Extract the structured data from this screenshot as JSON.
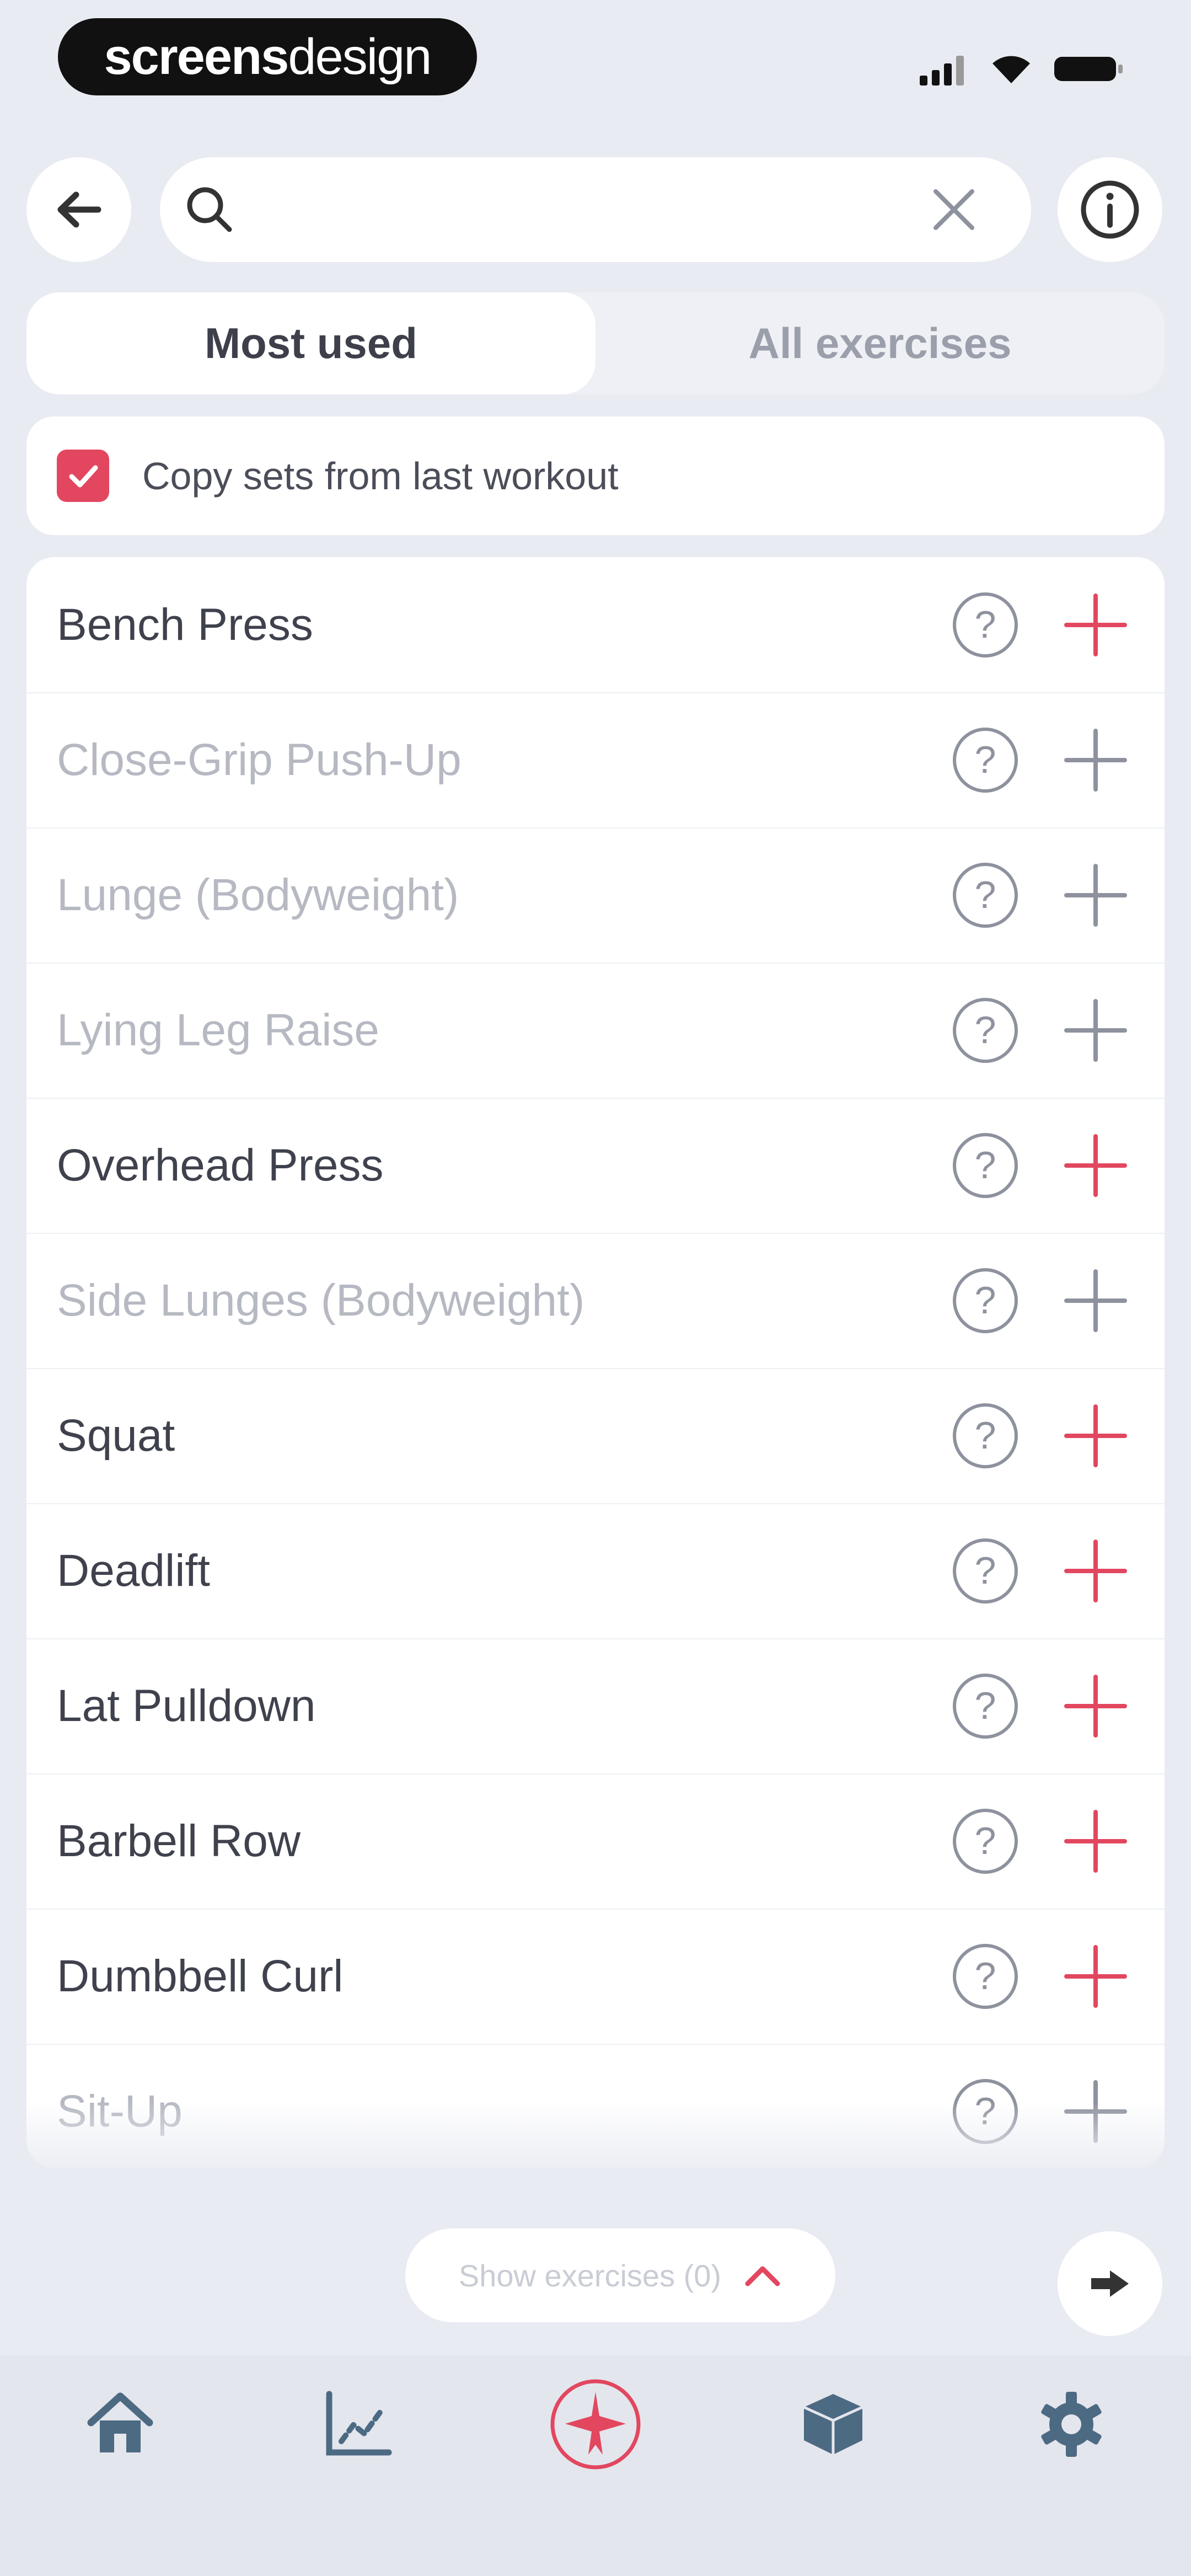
{
  "status_bar": {
    "brand": {
      "bold": "screens",
      "light": "design"
    },
    "icons": [
      "signal-icon",
      "wifi-icon",
      "battery-icon"
    ]
  },
  "header": {
    "back_icon": "arrow-left-icon",
    "search": {
      "placeholder": "",
      "value": ""
    },
    "clear_icon": "close-icon",
    "info_icon": "info-icon"
  },
  "tabs": [
    {
      "label": "Most used",
      "active": true
    },
    {
      "label": "All exercises",
      "active": false
    }
  ],
  "copy_sets": {
    "label": "Copy sets from last workout",
    "checked": true
  },
  "exercises": [
    {
      "name": "Bench Press",
      "used": true
    },
    {
      "name": "Close-Grip Push-Up",
      "used": false
    },
    {
      "name": "Lunge (Bodyweight)",
      "used": false
    },
    {
      "name": "Lying Leg Raise",
      "used": false
    },
    {
      "name": "Overhead Press",
      "used": true
    },
    {
      "name": "Side Lunges (Bodyweight)",
      "used": false
    },
    {
      "name": "Squat",
      "used": true
    },
    {
      "name": "Deadlift",
      "used": true
    },
    {
      "name": "Lat Pulldown",
      "used": true
    },
    {
      "name": "Barbell Row",
      "used": true
    },
    {
      "name": "Dumbbell Curl",
      "used": true
    },
    {
      "name": "Sit-Up",
      "used": false
    }
  ],
  "show_exercises": {
    "label": "Show exercises (0)",
    "icon": "chevron-up-icon"
  },
  "next_icon": "arrow-right-icon",
  "bottom_nav": [
    {
      "name": "home-icon",
      "active": false
    },
    {
      "name": "chart-icon",
      "active": false
    },
    {
      "name": "workout-icon",
      "active": true
    },
    {
      "name": "box-icon",
      "active": false
    },
    {
      "name": "settings-icon",
      "active": false
    }
  ],
  "colors": {
    "accent": "#e2475f",
    "background": "#e9ebf2",
    "text_primary": "#3f424d",
    "text_muted": "#b6b9c2",
    "icon_gray": "#8e929e"
  }
}
